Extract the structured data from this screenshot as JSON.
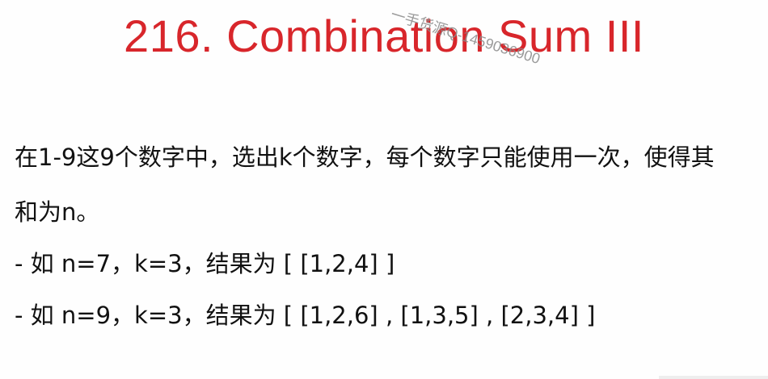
{
  "title": "216. Combination Sum III",
  "watermark": "一手货源Q-1459036900",
  "description": {
    "line1": "在1-9这9个数字中，选出k个数字，每个数字只能使用一次，使得其",
    "line2": "和为n。"
  },
  "examples": [
    "-  如 n=7，k=3，结果为 [ [1,2,4] ]",
    "-  如 n=9，k=3，结果为 [ [1,2,6] , [1,3,5] , [2,3,4] ]"
  ]
}
